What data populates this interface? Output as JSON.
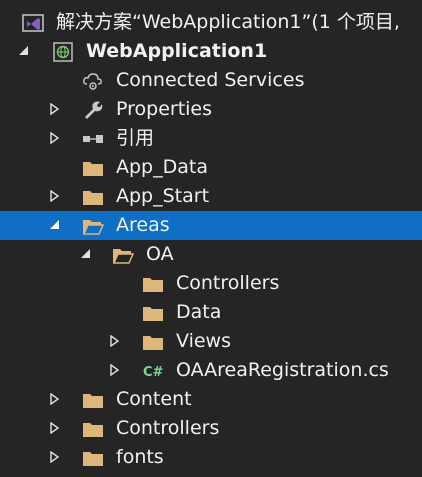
{
  "solution": {
    "title": "解决方案“WebApplication1”(1 个项目,"
  },
  "colors": {
    "background": "#252526",
    "selection": "#0e6fc5",
    "folder": "#dcb67a",
    "text": "#f1f1f1",
    "vs_purple": "#865fc5",
    "csharp_green": "#7bd88f"
  },
  "tree": {
    "project": "WebApplication1",
    "connected_services": "Connected Services",
    "properties": "Properties",
    "references": "引用",
    "app_data": "App_Data",
    "app_start": "App_Start",
    "areas": "Areas",
    "oa": "OA",
    "oa_controllers": "Controllers",
    "oa_data": "Data",
    "oa_views": "Views",
    "oa_registration": "OAAreaRegistration.cs",
    "content": "Content",
    "controllers": "Controllers",
    "fonts": "fonts"
  },
  "icons": {
    "solution": "visual-studio-icon",
    "project": "web-project-globe-icon",
    "connected_services": "cloud-gear-icon",
    "properties": "wrench-icon",
    "references": "references-icon",
    "folder": "folder-icon",
    "folder_open": "folder-open-icon",
    "csharp": "csharp-file-icon"
  }
}
